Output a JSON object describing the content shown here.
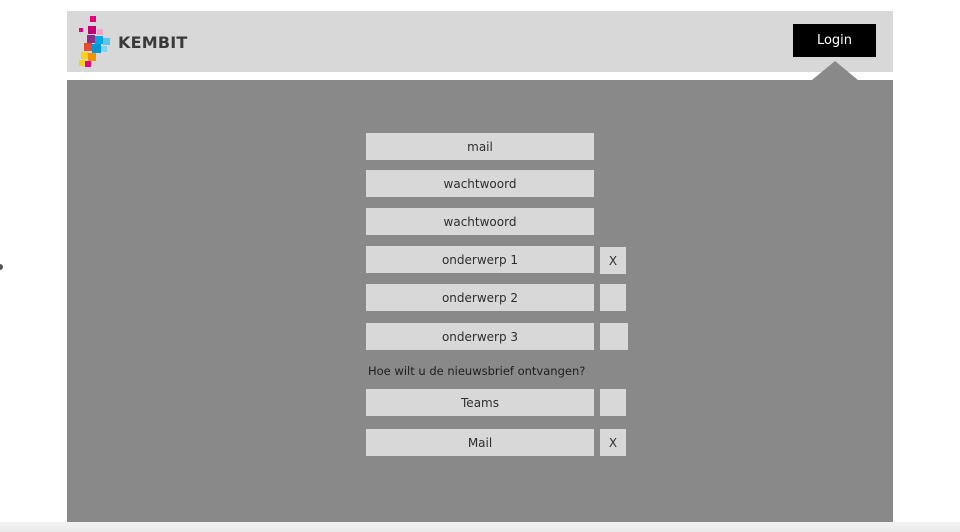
{
  "header": {
    "brand": "KEMBIT",
    "login_label": "Login"
  },
  "form": {
    "fields": [
      {
        "label": "mail"
      },
      {
        "label": "wachtwoord"
      },
      {
        "label": "wachtwoord"
      }
    ],
    "subjects": [
      {
        "label": "onderwerp 1",
        "checked": true,
        "mark": "X"
      },
      {
        "label": "onderwerp 2",
        "checked": false,
        "mark": ""
      },
      {
        "label": "onderwerp 3",
        "checked": false,
        "mark": ""
      }
    ],
    "newsletter_question": "Hoe wilt u de nieuwsbrief ontvangen?",
    "newsletter_options": [
      {
        "label": "Teams",
        "checked": false,
        "mark": ""
      },
      {
        "label": "Mail",
        "checked": true,
        "mark": "X"
      }
    ]
  },
  "colors": {
    "header_bg": "#d8d8d8",
    "panel_bg": "#898989",
    "field_bg": "#d8d8d8",
    "button_bg": "#000000",
    "logo_magenta": "#e3007d",
    "logo_cyan": "#00a8e0",
    "logo_yellow": "#f7d117"
  }
}
